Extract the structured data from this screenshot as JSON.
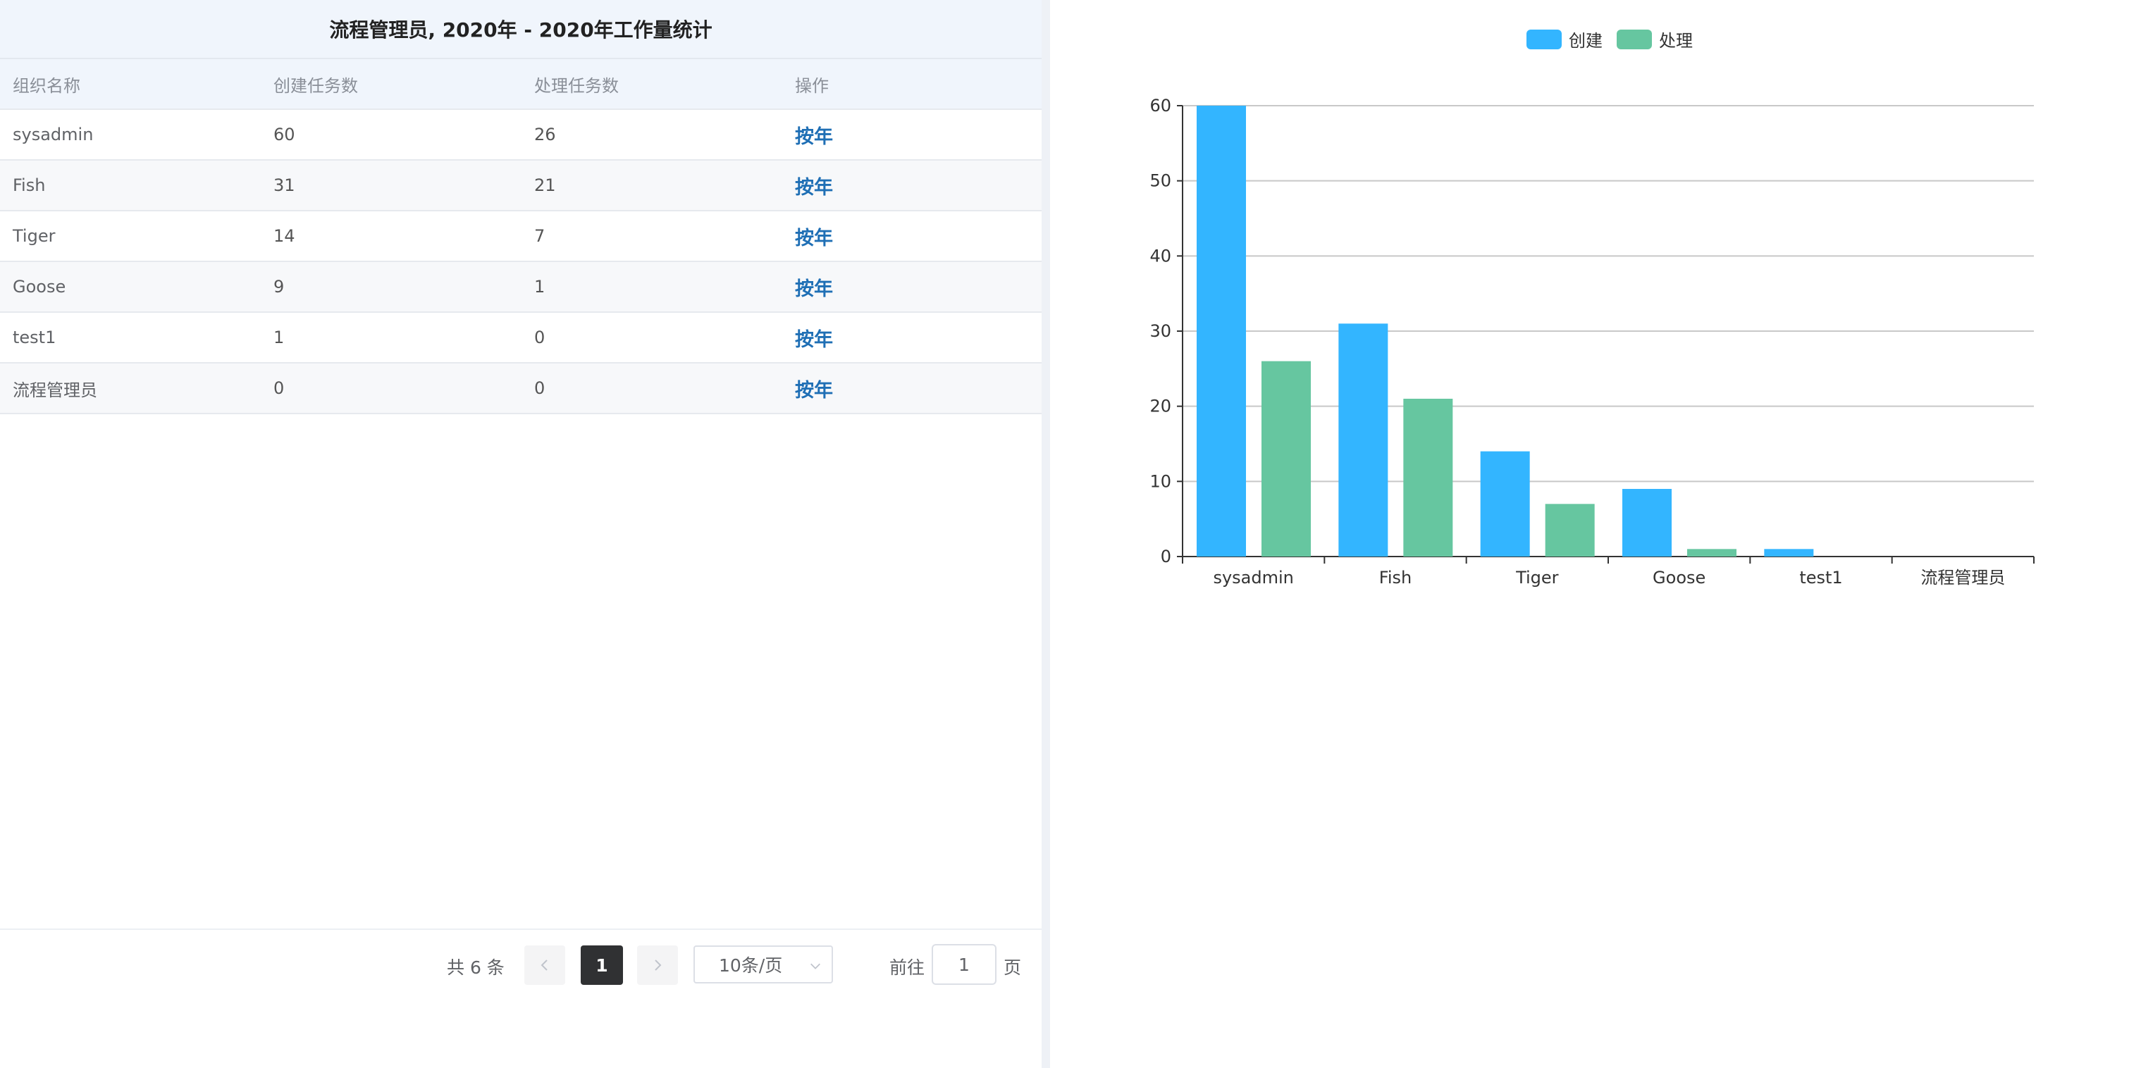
{
  "table": {
    "title": "流程管理员, 2020年 - 2020年工作量统计",
    "columns": [
      "组织名称",
      "创建任务数",
      "处理任务数",
      "操作"
    ],
    "rows": [
      {
        "org": "sysadmin",
        "created": "60",
        "handled": "26",
        "action": "按年"
      },
      {
        "org": "Fish",
        "created": "31",
        "handled": "21",
        "action": "按年"
      },
      {
        "org": "Tiger",
        "created": "14",
        "handled": "7",
        "action": "按年"
      },
      {
        "org": "Goose",
        "created": "9",
        "handled": "1",
        "action": "按年"
      },
      {
        "org": "test1",
        "created": "1",
        "handled": "0",
        "action": "按年"
      },
      {
        "org": "流程管理员",
        "created": "0",
        "handled": "0",
        "action": "按年"
      }
    ]
  },
  "pagination": {
    "total_label": "共 6 条",
    "current_page": "1",
    "page_size_label": "10条/页",
    "goto_label": "前往",
    "goto_value": "1",
    "page_unit": "页",
    "prev_icon": "chevron-left-icon",
    "next_icon": "chevron-right-icon"
  },
  "chart_data": {
    "type": "bar",
    "categories": [
      "sysadmin",
      "Fish",
      "Tiger",
      "Goose",
      "test1",
      "流程管理员"
    ],
    "series": [
      {
        "name": "创建",
        "values": [
          60,
          31,
          14,
          9,
          1,
          0
        ],
        "color": "#33b5ff"
      },
      {
        "name": "处理",
        "values": [
          26,
          21,
          7,
          1,
          0,
          0
        ],
        "color": "#66c6a0"
      }
    ],
    "ylim": [
      0,
      60
    ],
    "yticks": [
      0,
      10,
      20,
      30,
      40,
      50,
      60
    ],
    "grid": true,
    "legend": "top-center"
  }
}
